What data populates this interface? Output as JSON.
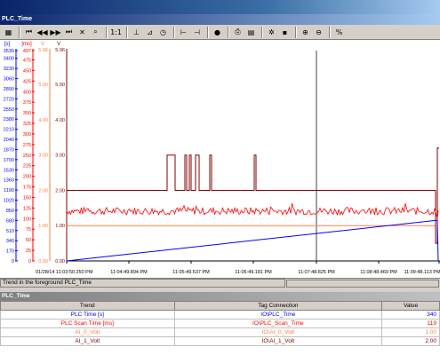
{
  "window": {
    "title": "PLC_Time"
  },
  "toolbar": {
    "buttons": [
      {
        "name": "edit-icon",
        "glyph": "▦"
      },
      {
        "name": "first-icon",
        "glyph": "⏮"
      },
      {
        "name": "rewind-icon",
        "glyph": "◀◀"
      },
      {
        "name": "forward-icon",
        "glyph": "▶▶"
      },
      {
        "name": "last-icon",
        "glyph": "⏭"
      },
      {
        "name": "stop-icon",
        "glyph": "✕"
      },
      {
        "name": "zoom-icon",
        "glyph": "⌕"
      },
      {
        "name": "one-to-one-icon",
        "glyph": "1:1"
      },
      {
        "name": "ruler-icon",
        "glyph": "⊥"
      },
      {
        "name": "zoom-area-icon",
        "glyph": "⊿"
      },
      {
        "name": "time-icon",
        "glyph": "◷"
      },
      {
        "name": "prev-axis-icon",
        "glyph": "⊢"
      },
      {
        "name": "next-axis-icon",
        "glyph": "⊣"
      },
      {
        "name": "start-icon",
        "glyph": "●"
      },
      {
        "name": "print-icon",
        "glyph": "⎙"
      },
      {
        "name": "select-trend-icon",
        "glyph": "▤"
      },
      {
        "name": "config-icon",
        "glyph": "✲"
      },
      {
        "name": "save-icon",
        "glyph": "▪"
      },
      {
        "name": "zoom-in-icon",
        "glyph": "⊕"
      },
      {
        "name": "zoom-out-icon",
        "glyph": "⊖"
      },
      {
        "name": "percent-icon",
        "glyph": "%"
      }
    ]
  },
  "axes": {
    "unit_s": "[s]",
    "unit_ms": "[ms]",
    "unit_v1": "V",
    "unit_v2": "V",
    "s_ticks": [
      "3530",
      "3400",
      "3230",
      "3060",
      "2890",
      "2720",
      "2550",
      "2380",
      "2210",
      "2040",
      "1870",
      "1700",
      "1530",
      "1360",
      "1190",
      "1020",
      "850",
      "680",
      "510",
      "340",
      "170",
      "0"
    ],
    "ms_ticks": [
      "497",
      "475",
      "450",
      "425",
      "400",
      "375",
      "350",
      "325",
      "300",
      "275",
      "250",
      "225",
      "200",
      "175",
      "150",
      "125",
      "100",
      "75",
      "50",
      "25",
      "0"
    ],
    "v1_ticks": [
      "5.00",
      "4.00",
      "3.00",
      "2.00",
      "1.00",
      "0.00"
    ],
    "v1_top": "5.96",
    "v2_ticks": [
      "5.00",
      "4.00",
      "3.00",
      "2.00",
      "1.00",
      "0.00"
    ],
    "v2_top": "5.96"
  },
  "time_axis": {
    "labels": [
      "01/28/14 11:03:50.250 PM",
      "11:04:49.894 PM",
      "11:05:49.537 PM",
      "11:06:49.181 PM",
      "11:07:48.825 PM",
      "11:08:48.469 PM",
      "11:09:48.113 PM"
    ]
  },
  "status": {
    "text": "Trend in the foreground PLC_Time"
  },
  "table": {
    "title": "PLC_Time",
    "headers": [
      "Trend",
      "Tag Connection",
      "Value"
    ],
    "rows": [
      {
        "trend": "PLC Time [s]",
        "tag": "IO\\PLC_Time",
        "value": "340",
        "color": "#0000ff"
      },
      {
        "trend": "PLC Scan Time [ms]",
        "tag": "IO\\PLC_Scan_Time",
        "value": "119",
        "color": "#ff0000"
      },
      {
        "trend": "AI_0_Volt",
        "tag": "IO\\AI_0_Volt",
        "value": "1.00",
        "color": "#ff8040"
      },
      {
        "trend": "AI_1_Volt",
        "tag": "IO\\AI_1_Volt",
        "value": "2.00",
        "color": "#800000"
      }
    ]
  },
  "colors": {
    "plc_time": "#0000ff",
    "scan_time": "#ff0000",
    "ai0": "#ff8040",
    "ai1": "#800000"
  }
}
